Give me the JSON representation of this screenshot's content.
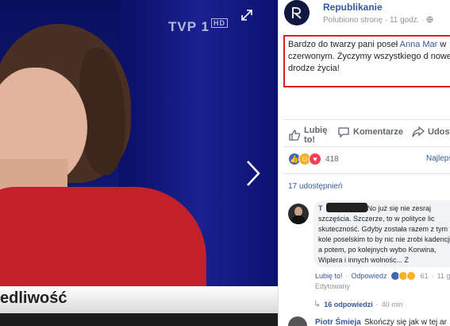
{
  "viewer": {
    "channel_logo": "TVP",
    "channel_number": "1",
    "channel_badge": "HD",
    "ticker_text": "edliwość",
    "expand_icon": "expand-icon",
    "next_icon": "chevron-right-icon"
  },
  "post": {
    "page_name": "Republikanie",
    "meta": "Polubiono stronę · 11 godz. · ",
    "text_before": "Bardzo do twarzy pani poseł ",
    "mention": "Anna Mar",
    "text_after": " w czerwonym. Życzymy wszystkiego d nowej drodze życia!",
    "highlight_color": "#e02020"
  },
  "actions": {
    "like": "Lubię to!",
    "comment": "Komentarze",
    "share": "Udost"
  },
  "reactions": {
    "count": "418",
    "sort_label": "Najlepsi"
  },
  "shares": "17 udostępnień",
  "comment": {
    "author_initial": "T",
    "text": "No już się nie zesraj szczęścia. Szczerze, to w polityce lic skuteczność. Gdyby została razem z tym kole poselskim to by nic nie zrobi kadencji, a potem, po kolejnych wybo Korwina, Wiplera i innych wolnośc... Z",
    "like": "Lubię to!",
    "reply": "Odpowiedz",
    "reaction_count": "61",
    "time": "11 g",
    "edited": "Edytowany",
    "replies_count": "16 odpowiedzi",
    "replies_time": "40 min"
  },
  "next_comment": {
    "author": "Piotr Śmieja",
    "text": "Skończy się jak w tej ar"
  }
}
